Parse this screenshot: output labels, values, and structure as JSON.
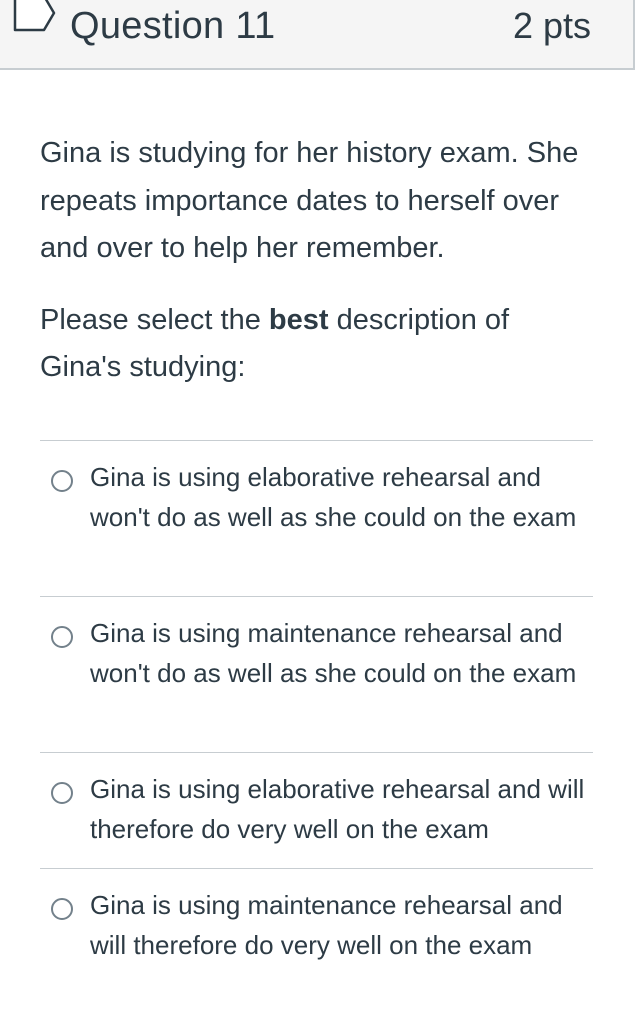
{
  "header": {
    "title": "Question 11",
    "points": "2 pts",
    "flag_icon": "flag-outline-icon"
  },
  "prompt": {
    "paragraph1": "Gina is studying for her history exam. She repeats importance dates to herself over and over to help her remember.",
    "paragraph2_before": "Please select the ",
    "paragraph2_bold": "best",
    "paragraph2_after": " description of Gina's studying:"
  },
  "answers": [
    {
      "label": "Gina is using elaborative rehearsal and won't do as well as she could on the exam",
      "selected": false
    },
    {
      "label": "Gina is using maintenance rehearsal and won't do as well as she could on the exam",
      "selected": false
    },
    {
      "label": "Gina is using elaborative rehearsal and will therefore do very well on the exam",
      "selected": false
    },
    {
      "label": "Gina is using maintenance rehearsal and will therefore do very well on the exam",
      "selected": false
    }
  ],
  "colors": {
    "text": "#2d3b45",
    "header_bg": "#f5f5f5",
    "border": "#c7cdd1",
    "radio_border": "#73818b",
    "flag_stroke": "#2d3b45"
  }
}
